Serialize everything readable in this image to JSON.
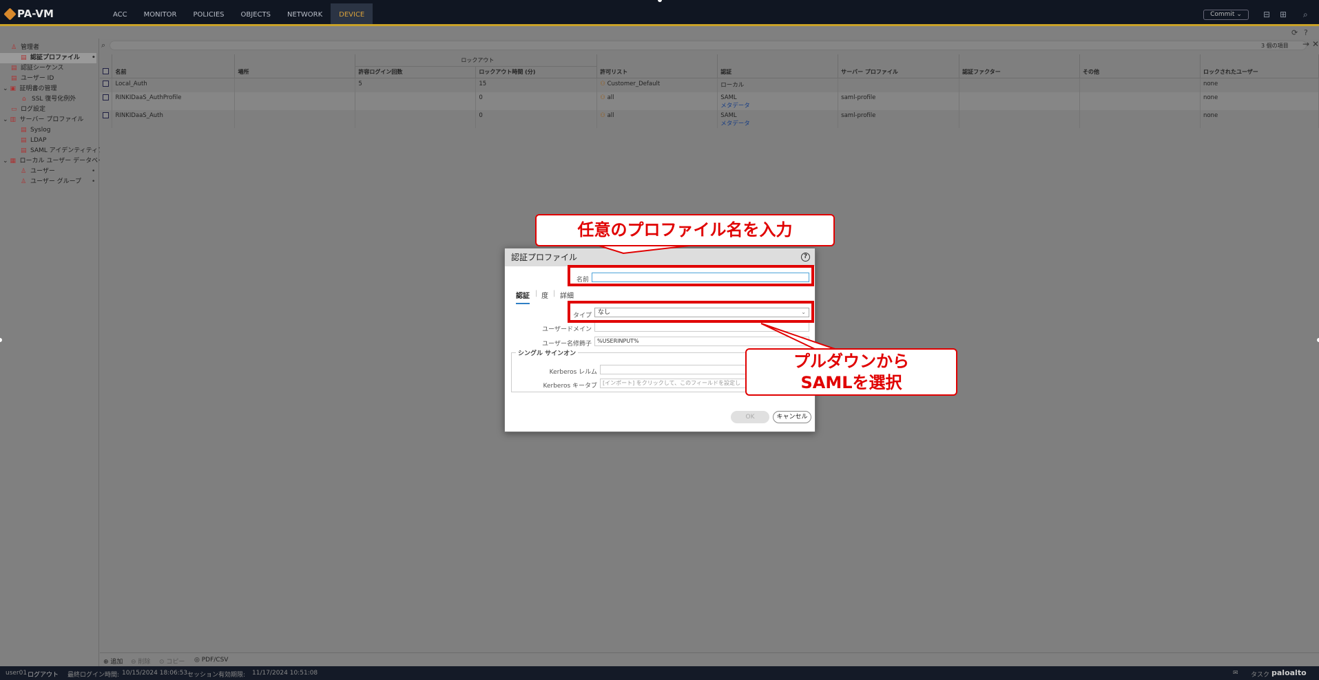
{
  "app": {
    "title": "PA-VM"
  },
  "nav": [
    "ACC",
    "MONITOR",
    "POLICIES",
    "OBJECTS",
    "NETWORK",
    "DEVICE"
  ],
  "topbar": {
    "commit": "Commit ⌄"
  },
  "sidebar": {
    "items": [
      {
        "label": "管理者",
        "icon": "user-icon"
      },
      {
        "label": "認証プロファイル",
        "icon": "id-card-icon"
      },
      {
        "label": "認証シーケンス",
        "icon": "id-card-icon"
      },
      {
        "label": "ユーザー ID",
        "icon": "id-card-icon"
      },
      {
        "label": "証明書の管理",
        "icon": "certificate-icon"
      },
      {
        "label": "SSL 復号化例外",
        "icon": "lock-icon"
      },
      {
        "label": "ログ設定",
        "icon": "log-icon"
      },
      {
        "label": "サーバー プロファイル",
        "icon": "server-icon"
      },
      {
        "label": "Syslog",
        "icon": "document-icon"
      },
      {
        "label": "LDAP",
        "icon": "document-icon"
      },
      {
        "label": "SAML アイデンティティプ",
        "icon": "document-icon"
      },
      {
        "label": "ローカル ユーザー データベー",
        "icon": "database-icon"
      },
      {
        "label": "ユーザー",
        "icon": "user-icon"
      },
      {
        "label": "ユーザー グループ",
        "icon": "users-icon"
      }
    ]
  },
  "grid": {
    "count": "3 個の項目",
    "group_header": "ロックアウト",
    "columns": [
      "名前",
      "場所",
      "許容ログイン回数",
      "ロックアウト時間 (分)",
      "許可リスト",
      "認証",
      "サーバー プロファイル",
      "認証ファクター",
      "その他",
      "ロックされたユーザー"
    ],
    "rows": [
      {
        "name": "Local_Auth",
        "location": "",
        "attempts": "5",
        "lockout": "15",
        "allow": "Customer_Default",
        "auth": "ローカル",
        "auth_sub": "",
        "server": "",
        "factor": "",
        "other": "",
        "locked": "none"
      },
      {
        "name": "RINKIDaaS_AuthProfile",
        "location": "",
        "attempts": "",
        "lockout": "0",
        "allow": "all",
        "auth": "SAML",
        "auth_sub": "メタデータ",
        "server": "saml-profile",
        "factor": "",
        "other": "",
        "locked": "none"
      },
      {
        "name": "RINKIDaaS_Auth",
        "location": "",
        "attempts": "",
        "lockout": "0",
        "allow": "all",
        "auth": "SAML",
        "auth_sub": "メタデータ",
        "server": "saml-profile",
        "factor": "",
        "other": "",
        "locked": "none"
      }
    ]
  },
  "bottom_toolbar": {
    "add": "追加",
    "delete": "削除",
    "copy": "コピー",
    "pdf": "PDF/CSV"
  },
  "statusbar": {
    "user": "user01",
    "logout": "ログアウト",
    "last_login_label": "最終ログイン時間:",
    "last_login": "10/15/2024 18:06:53",
    "session_label": "セッション有効期限:",
    "session": "11/17/2024 10:51:08",
    "tasks": "タスク",
    "brand": "paloalto"
  },
  "dialog": {
    "title": "認証プロファイル",
    "name_label": "名前",
    "name_value": "",
    "tabs": [
      "認証",
      "度",
      "詳細"
    ],
    "type_label": "タイプ",
    "type_value": "なし",
    "user_domain_label": "ユーザードメイン",
    "username_modifier_label": "ユーザー名修飾子",
    "username_modifier_value": "%USERINPUT%",
    "sso_legend": "シングル サインオン",
    "kerberos_realm_label": "Kerberos レルム",
    "kerberos_keytab_label": "Kerberos キータブ",
    "kerberos_keytab_placeholder": "[インポート] をクリックして、このフィールドを設定し",
    "ok": "OK",
    "cancel": "キャンセル"
  },
  "annotations": {
    "callout1": "任意のプロファイル名を入力",
    "callout2_line1": "プルダウンから",
    "callout2_line2": "SAMLを選択",
    "color": "#e00000"
  }
}
